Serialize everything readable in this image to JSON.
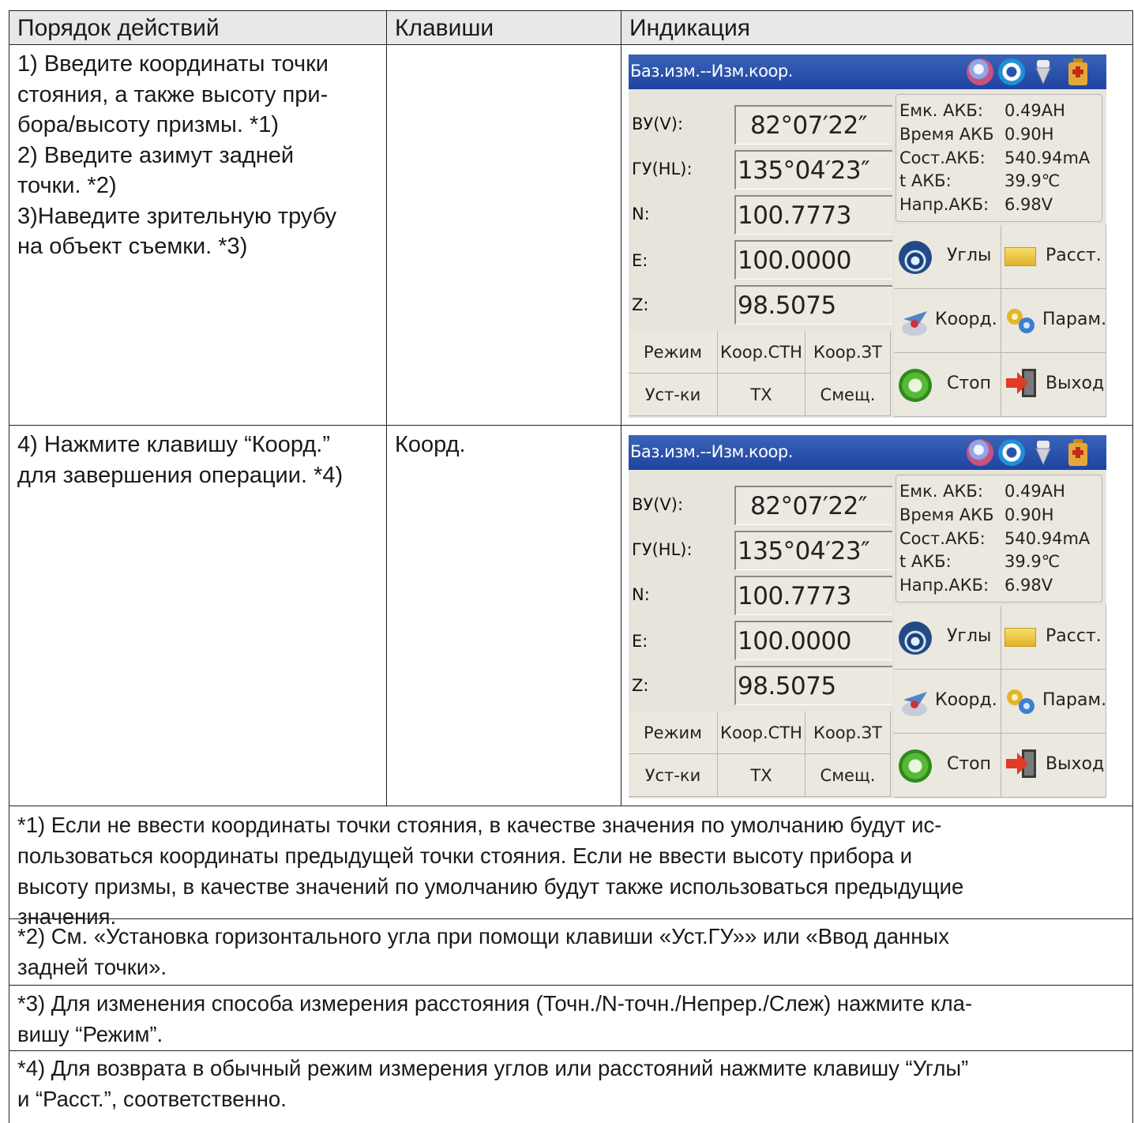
{
  "header": {
    "col1": "Порядок действий",
    "col2": "Клавиши",
    "col3": "Индикация"
  },
  "rows": [
    {
      "steps": "1) Введите координаты точки\nстояния, а также высоту при-\nбора/высоту призмы. *1)\n2) Введите азимут задней\nточки. *2)\n3)Наведите зрительную трубу\nна объект съемки. *3)",
      "key": ""
    },
    {
      "steps": "4) Нажмите клавишу “Коорд.”\nдля завершения операции. *4)",
      "key": "Коорд."
    }
  ],
  "screen": {
    "title": "Баз.изм.--Изм.коор.",
    "fields": [
      {
        "label": "ВУ(V):",
        "value": " 82°07′22″"
      },
      {
        "label": "ГУ(HL):",
        "value": "135°04′23″"
      },
      {
        "label": "N:",
        "value": "100.7773"
      },
      {
        "label": "E:",
        "value": "100.0000"
      },
      {
        "label": "Z:",
        "value": "98.5075"
      }
    ],
    "battery": [
      {
        "label": "Емк. АКБ:",
        "value": "0.49AH"
      },
      {
        "label": "Время АКБ",
        "value": "0.90H"
      },
      {
        "label": "Сост.АКБ:",
        "value": "540.94mA"
      },
      {
        "label": "t АКБ:",
        "value": "39.9℃"
      },
      {
        "label": "Напр.АКБ:",
        "value": "6.98V"
      }
    ],
    "softkeys": [
      "Режим",
      "Коор.СТН",
      "Коор.ЗТ",
      "Уст-ки",
      "ТХ",
      "Смещ."
    ],
    "buttons": {
      "angles": "Углы",
      "dist": "Расст.",
      "coord": "Коорд.",
      "param": "Парам.",
      "stop": "Стоп",
      "exit": "Выход"
    },
    "icons": [
      "compass-icon",
      "gear-icon",
      "prism-icon",
      "battery-icon"
    ]
  },
  "notes": [
    "*1) Если не ввести координаты точки стояния, в качестве значения по умолчанию будут ис-\nпользоваться координаты предыдущей точки стояния. Если не ввести высоту прибора и\nвысоту призмы, в качестве значений по умолчанию будут также использоваться предыдущие\nзначения.",
    "*2) См. «Установка горизонтального угла при помощи клавиши «Уст.ГУ»» или «Ввод данных\nзадней точки».",
    "*3) Для изменения способа измерения расстояния (Точн./N-точн./Непрер./Слеж) нажмите кла-\nвишу “Режим”.",
    "*4) Для возврата в обычный режим измерения углов или расстояний нажмите клавишу “Углы”\nи “Расст.”, соответственно."
  ],
  "colors": {
    "titlebar": "#2a52ad",
    "screen_bg": "#e7e4db",
    "header_bg": "#e8e8e8"
  }
}
